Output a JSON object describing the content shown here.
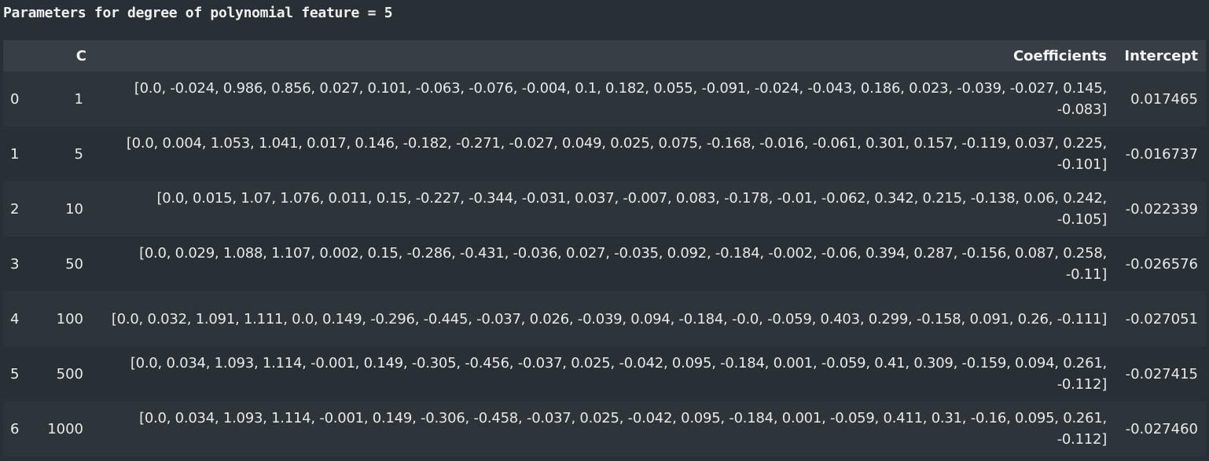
{
  "caption": "Parameters for degree of polynomial feature = 5",
  "table": {
    "columns": {
      "index": "",
      "c": "C",
      "coefficients": "Coefficients",
      "intercept": "Intercept"
    },
    "rows": [
      {
        "index": "0",
        "c": "1",
        "coefficients": "[0.0, -0.024, 0.986, 0.856, 0.027, 0.101, -0.063, -0.076, -0.004, 0.1, 0.182, 0.055, -0.091, -0.024, -0.043, 0.186, 0.023, -0.039, -0.027, 0.145, -0.083]",
        "intercept": "0.017465"
      },
      {
        "index": "1",
        "c": "5",
        "coefficients": "[0.0, 0.004, 1.053, 1.041, 0.017, 0.146, -0.182, -0.271, -0.027, 0.049, 0.025, 0.075, -0.168, -0.016, -0.061, 0.301, 0.157, -0.119, 0.037, 0.225, -0.101]",
        "intercept": "-0.016737"
      },
      {
        "index": "2",
        "c": "10",
        "coefficients": "[0.0, 0.015, 1.07, 1.076, 0.011, 0.15, -0.227, -0.344, -0.031, 0.037, -0.007, 0.083, -0.178, -0.01, -0.062, 0.342, 0.215, -0.138, 0.06, 0.242, -0.105]",
        "intercept": "-0.022339"
      },
      {
        "index": "3",
        "c": "50",
        "coefficients": "[0.0, 0.029, 1.088, 1.107, 0.002, 0.15, -0.286, -0.431, -0.036, 0.027, -0.035, 0.092, -0.184, -0.002, -0.06, 0.394, 0.287, -0.156, 0.087, 0.258, -0.11]",
        "intercept": "-0.026576"
      },
      {
        "index": "4",
        "c": "100",
        "coefficients": "[0.0, 0.032, 1.091, 1.111, 0.0, 0.149, -0.296, -0.445, -0.037, 0.026, -0.039, 0.094, -0.184, -0.0, -0.059, 0.403, 0.299, -0.158, 0.091, 0.26, -0.111]",
        "intercept": "-0.027051"
      },
      {
        "index": "5",
        "c": "500",
        "coefficients": "[0.0, 0.034, 1.093, 1.114, -0.001, 0.149, -0.305, -0.456, -0.037, 0.025, -0.042, 0.095, -0.184, 0.001, -0.059, 0.41, 0.309, -0.159, 0.094, 0.261, -0.112]",
        "intercept": "-0.027415"
      },
      {
        "index": "6",
        "c": "1000",
        "coefficients": "[0.0, 0.034, 1.093, 1.114, -0.001, 0.149, -0.306, -0.458, -0.037, 0.025, -0.042, 0.095, -0.184, 0.001, -0.059, 0.411, 0.31, -0.16, 0.095, 0.261, -0.112]",
        "intercept": "-0.027460"
      }
    ]
  }
}
